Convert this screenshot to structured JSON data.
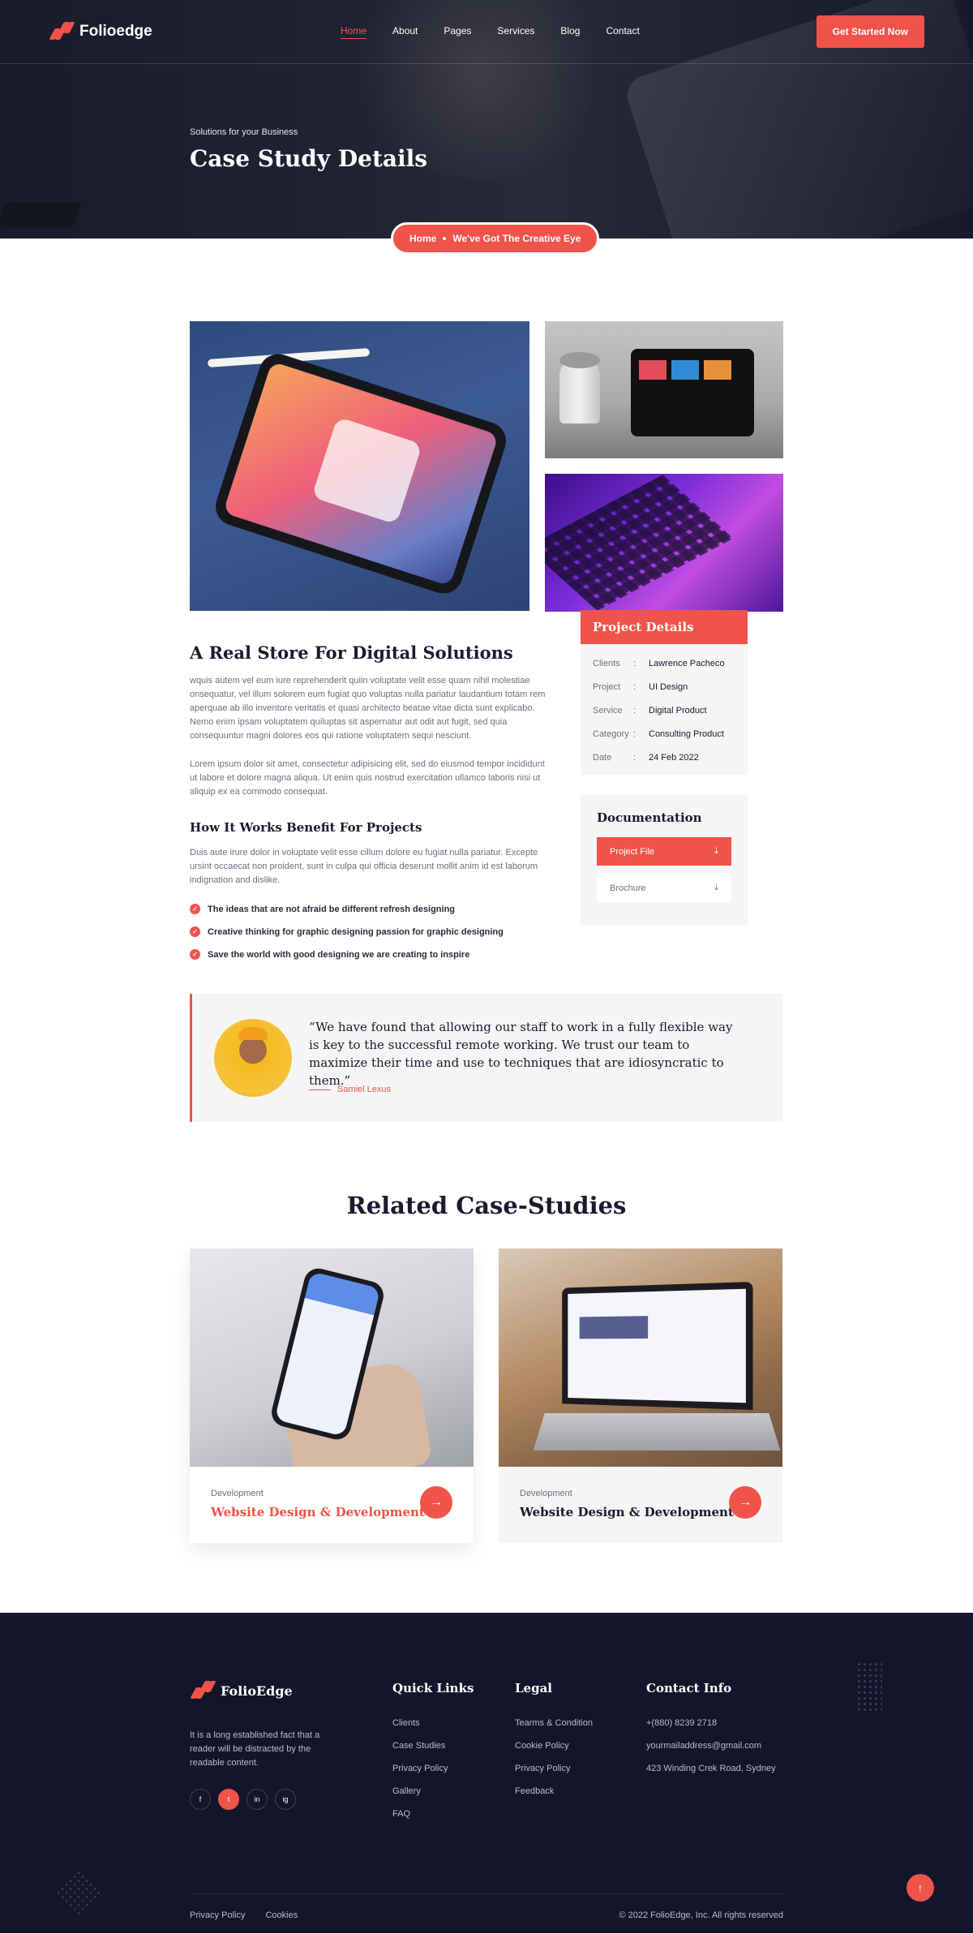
{
  "brand": {
    "name": "Folioedge",
    "footer_name": "FolioEdge",
    "accent": "#f0534a",
    "dark": "#13162b"
  },
  "nav": {
    "items": [
      {
        "label": "Home",
        "active": true
      },
      {
        "label": "About"
      },
      {
        "label": "Pages"
      },
      {
        "label": "Services"
      },
      {
        "label": "Blog"
      },
      {
        "label": "Contact"
      }
    ],
    "cta": "Get Started Now"
  },
  "hero": {
    "subtitle": "Solutions for your Business",
    "title": "Case Study Details",
    "breadcrumb": {
      "home": "Home",
      "current": "We've Got The Creative Eye"
    }
  },
  "article": {
    "title": "A Real Store For Digital Solutions",
    "para1": "wquis autem vel eum iure reprehenderit quiin voluptate velit esse quam nihil molestiae onsequatur, vel illum solorem eum fugiat quo voluptas nulla pariatur laudantium totam rem aperquae ab illo inventore veritatis et quasi architecto beatae vitae dicta sunt explicabo. Nemo enim ipsam voluptatem quiluptas sit aspernatur aut odit aut fugit, sed quia consequuntur magni dolores eos qui ratione voluptatem sequi nesciunt.",
    "para2": "Lorem ipsum dolor sit amet, consectetur adipisicing elit, sed do eiusmod tempor incididunt ut labore et dolore magna aliqua. Ut enim quis nostrud exercitation ullamco laboris nisi ut aliquip ex ea commodo consequat.",
    "subtitle": "How It Works Benefit For Projects",
    "para3": "Duis aute irure dolor in voluptate velit esse cillum dolore eu fugiat nulla pariatur. Excepte ursint occaecat non proident, sunt in culpa qui officia deserunt mollit anim id est laborum indignation and dislike.",
    "checks": [
      "The ideas that are not afraid be different refresh designing",
      "Creative thinking for graphic designing passion for graphic designing",
      "Save the world with good designing we are creating to inspire"
    ]
  },
  "project_details": {
    "title": "Project Details",
    "rows": [
      {
        "key": "Clients",
        "value": "Lawrence Pacheco"
      },
      {
        "key": "Project",
        "value": "UI Design"
      },
      {
        "key": "Service",
        "value": "Digital Product"
      },
      {
        "key": "Category",
        "value": "Consulting Product"
      },
      {
        "key": "Date",
        "value": "24 Feb 2022"
      }
    ]
  },
  "documentation": {
    "title": "Documentation",
    "project_file": "Project File",
    "brochure": "Brochure"
  },
  "quote": {
    "text": "“We have found that allowing our staff to work in a fully flexible way is key to the successful remote working. We trust our team to maximize their time and use to techniques that are idiosyncratic to them.”",
    "author": "Samiel Lexus"
  },
  "related": {
    "title": "Related Case-Studies",
    "cards": [
      {
        "category": "Development",
        "title": "Website Design & Development"
      },
      {
        "category": "Development",
        "title": "Website Design & Development"
      }
    ]
  },
  "footer": {
    "about": "It is a long established fact that a reader will be distracted by the readable content.",
    "socials": [
      "f",
      "t",
      "in",
      "ig"
    ],
    "quick_links": {
      "title": "Quick Links",
      "items": [
        "Clients",
        "Case Studies",
        "Privacy Policy",
        "Gallery",
        "FAQ"
      ]
    },
    "legal": {
      "title": "Legal",
      "items": [
        "Tearms & Condition",
        "Cookie Policy",
        "Privacy Policy",
        "Feedback"
      ]
    },
    "contact": {
      "title": "Contact Info",
      "items": [
        "+(880) 8239 2718",
        "yourmailaddress@gmail.com",
        "423 Winding Crek Road, Sydney"
      ]
    },
    "bottom_links": [
      "Privacy Policy",
      "Cookies"
    ],
    "copyright": "© 2022 FolioEdge, Inc. All rights reserved"
  }
}
